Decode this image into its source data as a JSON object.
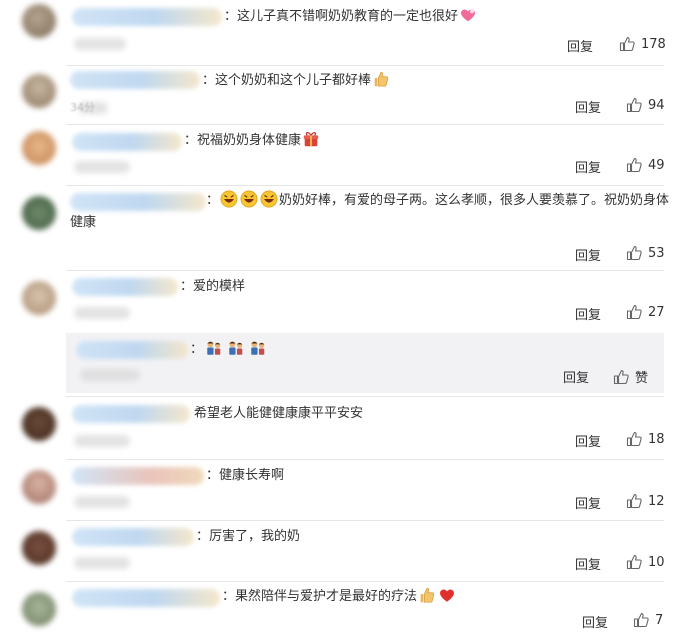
{
  "ui": {
    "reply_label": "回复",
    "like_label": "赞"
  },
  "colors": {
    "text": "#333333",
    "reply_bg": "#f2f2f5",
    "link_blue": "#bcd6f0"
  },
  "comments": [
    {
      "text": "：这儿子真不错啊奶奶教育的一定也很好",
      "likes": "178"
    },
    {
      "text": "：这个奶奶和这个儿子都好棒",
      "likes": "94"
    },
    {
      "text": "：祝福奶奶身体健康",
      "likes": "49"
    },
    {
      "text_before": "：",
      "text": "奶奶好棒，有爱的母子两。这么孝顺，很多人要羡慕了。祝奶奶身体健康",
      "likes": "53"
    },
    {
      "text": "：爱的模样",
      "likes": "27"
    },
    {
      "text": "：",
      "likes": ""
    },
    {
      "text": "希望老人能健健康康平平安安",
      "likes": "18"
    },
    {
      "text": "：健康长寿啊",
      "likes": "12"
    },
    {
      "text": "：厉害了，我的奶",
      "likes": "10"
    },
    {
      "text": "：果然陪伴与爱护才是最好的疗法",
      "likes": "7"
    }
  ],
  "partial_time": "34分"
}
